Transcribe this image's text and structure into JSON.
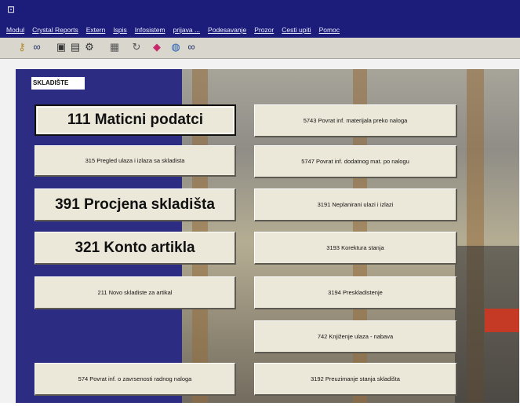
{
  "titlebar": {
    "app_icon": "app-window-icon"
  },
  "menubar": {
    "items": [
      "Modul",
      "Crystal Reports",
      "Extern",
      "Ispis",
      "Infosistem",
      "prijava ...",
      "Podesavanje",
      "Prozor",
      "Cesti upiti",
      "Pomoc"
    ]
  },
  "toolbar": {
    "icons": [
      "key-icon",
      "binoculars-icon",
      "printer-icon",
      "print-preview-icon",
      "printer-settings-icon",
      "document-icon",
      "refresh-icon",
      "eraser-icon",
      "globe-icon",
      "find-icon"
    ]
  },
  "form": {
    "title": "SKLADIŠTE",
    "left_buttons": [
      "111 Maticni podatci",
      "315 Pregled ulaza i izlaza sa skladista",
      "391 Procjena skladišta",
      "321 Konto artikla",
      "211 Novo skladiste za artikal",
      "574 Povrat inf. o zavrsenosti radnog naloga"
    ],
    "right_buttons": [
      "5743 Povrat inf. materijala preko naloga",
      "5747 Povrat inf. dodatnog mat. po nalogu",
      "3191 Neplanirani ulazi i izlazi",
      "3193 Korektura stanja",
      "3194 Preskladistenje",
      "742 Knjiženje ulaza - nabava",
      "3192 Preuzimanje stanja skladišta"
    ]
  },
  "colors": {
    "title_bar": "#1c1c7a",
    "toolbar": "#d9d6ce",
    "side_panel": "#2c2d82",
    "button_face": "#ece8d9"
  }
}
